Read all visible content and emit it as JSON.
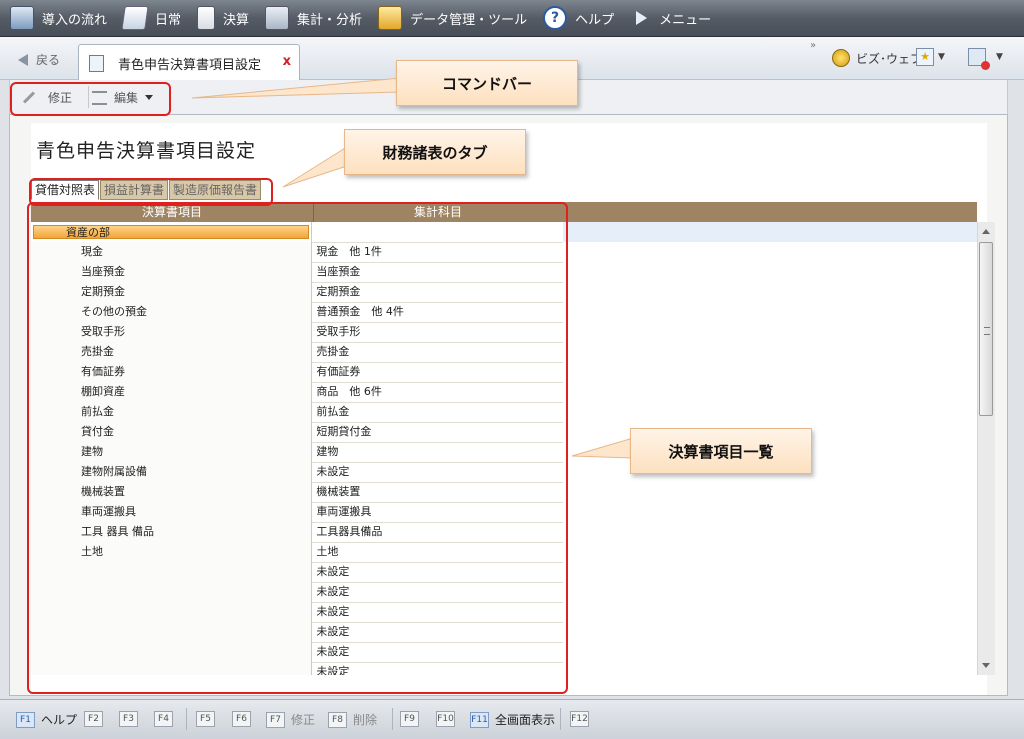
{
  "menu": {
    "items": [
      {
        "label": "導入の流れ",
        "icon": "flow-icon"
      },
      {
        "label": "日常",
        "icon": "daily-icon"
      },
      {
        "label": "決算",
        "icon": "settlement-icon"
      },
      {
        "label": "集計・分析",
        "icon": "analysis-icon"
      },
      {
        "label": "データ管理・ツール",
        "icon": "database-icon"
      },
      {
        "label": "ヘルプ",
        "icon": "help-icon"
      },
      {
        "label": "メニュー",
        "icon": "play-icon"
      }
    ]
  },
  "nav": {
    "back_label": "戻る",
    "tab_title": "青色申告決算書項目設定",
    "tab_close": "x",
    "overflow": "»",
    "bizweb_label": "ビズ･ウェブ"
  },
  "commandbar": {
    "edit_label": "修正",
    "menu_label": "編集"
  },
  "page": {
    "title": "青色申告決算書項目設定",
    "tabs": [
      "貸借対照表",
      "損益計算書",
      "製造原価報告書"
    ],
    "active_tab": 0
  },
  "grid": {
    "columns": [
      "決算書項目",
      "集計科目"
    ],
    "section_label": "資産の部",
    "rows": [
      {
        "item": "現金",
        "account": "現金　他 1件"
      },
      {
        "item": "当座預金",
        "account": "当座預金"
      },
      {
        "item": "定期預金",
        "account": "定期預金"
      },
      {
        "item": "その他の預金",
        "account": "普通預金　他 4件"
      },
      {
        "item": "受取手形",
        "account": "受取手形"
      },
      {
        "item": "売掛金",
        "account": "売掛金"
      },
      {
        "item": "有価証券",
        "account": "有価証券"
      },
      {
        "item": "棚卸資産",
        "account": "商品　他 6件"
      },
      {
        "item": "前払金",
        "account": "前払金"
      },
      {
        "item": "貸付金",
        "account": "短期貸付金"
      },
      {
        "item": "建物",
        "account": "建物"
      },
      {
        "item": "建物附属設備",
        "account": "未設定"
      },
      {
        "item": "機械装置",
        "account": "機械装置"
      },
      {
        "item": "車両運搬具",
        "account": "車両運搬具"
      },
      {
        "item": "工具 器具 備品",
        "account": "工具器具備品"
      },
      {
        "item": "土地",
        "account": "土地"
      },
      {
        "item": "",
        "account": "未設定"
      },
      {
        "item": "",
        "account": "未設定"
      },
      {
        "item": "",
        "account": "未設定"
      },
      {
        "item": "",
        "account": "未設定"
      },
      {
        "item": "",
        "account": "未設定"
      },
      {
        "item": "",
        "account": "未設定"
      }
    ]
  },
  "annotations": {
    "command_bar": "コマンドバー",
    "statement_tabs": "財務諸表のタブ",
    "item_list": "決算書項目一覧"
  },
  "footer": {
    "keys": [
      {
        "key": "F1",
        "label": "ヘルプ",
        "active": true
      },
      {
        "key": "F2",
        "label": ""
      },
      {
        "key": "F3",
        "label": ""
      },
      {
        "key": "F4",
        "label": ""
      },
      {
        "key": "F5",
        "label": ""
      },
      {
        "key": "F6",
        "label": ""
      },
      {
        "key": "F7",
        "label": "修正"
      },
      {
        "key": "F8",
        "label": "削除"
      },
      {
        "key": "F9",
        "label": ""
      },
      {
        "key": "F10",
        "label": ""
      },
      {
        "key": "F11",
        "label": "全画面表示",
        "active": true
      },
      {
        "key": "F12",
        "label": ""
      }
    ]
  }
}
